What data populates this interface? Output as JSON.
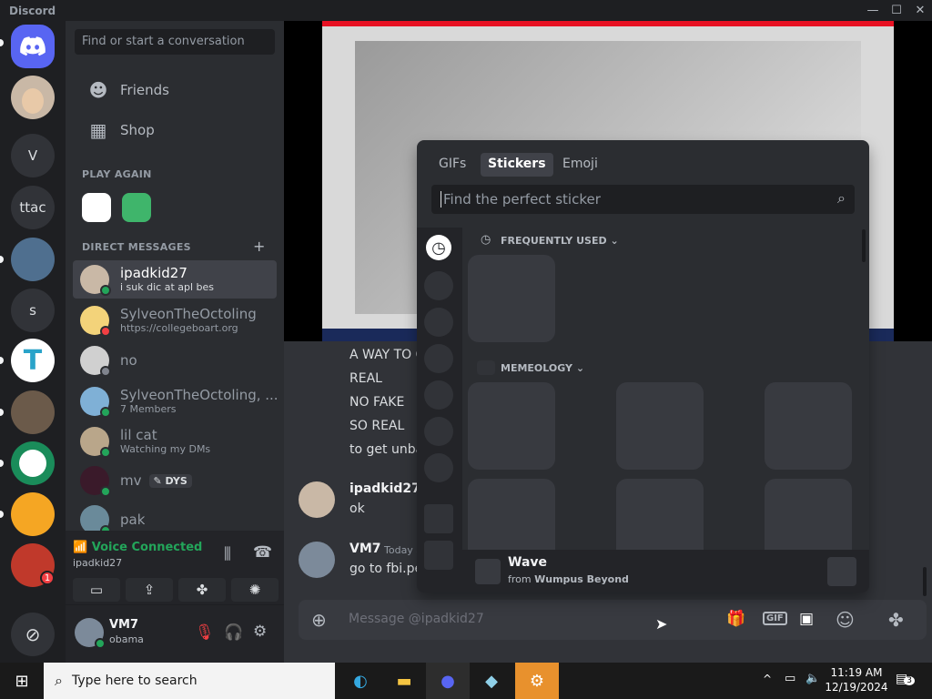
{
  "titlebar": {
    "app": "Discord"
  },
  "servers": [
    {
      "label": "",
      "icon": "discord-logo-icon"
    },
    {
      "label": "V"
    },
    {
      "label": "ttac"
    },
    {
      "label": "s"
    },
    {
      "label": "T"
    }
  ],
  "server_badge": "1",
  "dm_sidebar": {
    "search_placeholder": "Find or start a conversation",
    "friends": "Friends",
    "shop": "Shop",
    "play_again": "PLAY AGAIN",
    "direct_messages": "DIRECT MESSAGES",
    "add": "+",
    "dms": [
      {
        "name": "ipadkid27",
        "sub": "i suk dic at apl bes",
        "status": "online"
      },
      {
        "name": "SylveonTheOctoling",
        "sub": "https://collegeboart.org",
        "status": "dnd"
      },
      {
        "name": "no",
        "sub": "",
        "status": "offline"
      },
      {
        "name": "SylveonTheOctoling, ...",
        "sub": "7 Members",
        "status": "group"
      },
      {
        "name": "lil cat",
        "sub": "Watching my DMs",
        "status": "online"
      },
      {
        "name": "mv",
        "sub": "",
        "status": "online",
        "tag": "DYS"
      },
      {
        "name": "pak",
        "sub": "",
        "status": "online"
      }
    ]
  },
  "voice": {
    "status": "Voice Connected",
    "channel": "ipadkid27"
  },
  "user": {
    "name": "VM7",
    "status": "obama"
  },
  "chat": {
    "messages_top": [
      "A WAY TO G",
      "REAL",
      "NO FAKE",
      "SO REAL",
      "to get unba"
    ],
    "msg1": {
      "author": "ipadkid27",
      "text": "ok"
    },
    "msg2": {
      "author": "VM7",
      "time": "Today a",
      "text": "go to fbi.pe"
    },
    "composer_placeholder": "Message @ipadkid27"
  },
  "picker": {
    "tabs": [
      "GIFs",
      "Stickers",
      "Emoji"
    ],
    "active_tab": "Stickers",
    "search_placeholder": "Find the perfect sticker",
    "section1": "FREQUENTLY USED",
    "section2": "MEMEOLOGY",
    "footer_title": "Wave",
    "footer_from": "from",
    "footer_pack": "Wumpus Beyond"
  },
  "taskbar": {
    "search_placeholder": "Type here to search",
    "time": "11:19 AM",
    "date": "12/19/2024",
    "notifications": "3"
  },
  "colors": {
    "blurple": "#5865f2",
    "online": "#23a55a",
    "dnd": "#f23f43",
    "voice_green": "#23a55a",
    "taskbar_accent": "#e8912d"
  }
}
